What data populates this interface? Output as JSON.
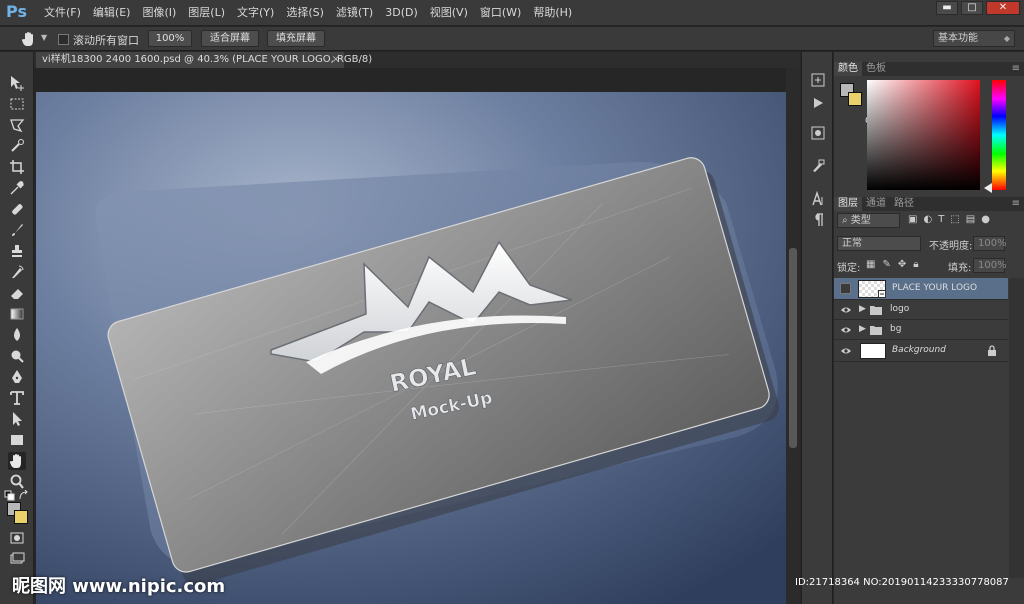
{
  "app": {
    "logo_text": "Ps"
  },
  "menu": {
    "items": [
      "文件(F)",
      "编辑(E)",
      "图像(I)",
      "图层(L)",
      "文字(Y)",
      "选择(S)",
      "滤镜(T)",
      "3D(D)",
      "视图(V)",
      "窗口(W)",
      "帮助(H)"
    ]
  },
  "window_controls": {
    "minimize": "▬",
    "maximize": "□",
    "close": "✕"
  },
  "options_bar": {
    "scroll_all_label": "滚动所有窗口",
    "btn_100": "100%",
    "btn_fit": "适合屏幕",
    "btn_fill": "填充屏幕",
    "workspace": "基本功能"
  },
  "document": {
    "tab_title": "vi样机18300 2400 1600.psd @ 40.3% (PLACE YOUR LOGO, RGB/8)",
    "close_glyph": "×"
  },
  "canvas_art": {
    "logo_title": "ROYAL",
    "logo_subtitle": "Mock-Up"
  },
  "color_panel": {
    "tabs": [
      "颜色",
      "色板"
    ],
    "fg_color": "#b8b8b8",
    "bg_color": "#e8d06a"
  },
  "layers_panel": {
    "tabs": [
      "图层",
      "通道",
      "路径"
    ],
    "filter_kind": "类型",
    "blend_mode": "正常",
    "opacity_label": "不透明度:",
    "opacity_value": "100%",
    "lock_label": "锁定:",
    "fill_label": "填充:",
    "fill_value": "100%",
    "layers": [
      {
        "name": "PLACE YOUR LOGO",
        "kind": "smart-object",
        "visible": false,
        "selected": true
      },
      {
        "name": "logo",
        "kind": "group",
        "visible": true
      },
      {
        "name": "bg",
        "kind": "group",
        "visible": true
      },
      {
        "name": "Background",
        "kind": "background",
        "visible": true,
        "locked": true
      }
    ]
  },
  "watermark": {
    "left_text": "昵图网 www.nipic.com",
    "right_text": "ID:21718364 NO:20190114233330778087"
  },
  "colors": {
    "accent": "#6fb3e8",
    "selected_layer": "#5a6f8a",
    "canvas_bg": "#45577a"
  }
}
